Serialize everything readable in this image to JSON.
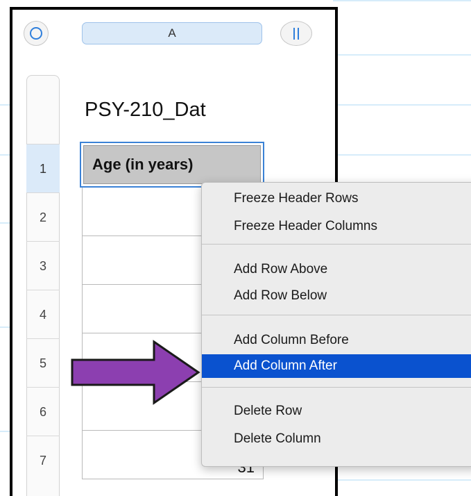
{
  "column_header": {
    "label": "A"
  },
  "table": {
    "title": "PSY-210_Dat",
    "header_cell": "Age (in years)",
    "rows": [
      "1",
      "2",
      "3",
      "4",
      "5",
      "6",
      "7"
    ],
    "partial_value_row7": "31"
  },
  "context_menu": {
    "groups": [
      [
        "Freeze Header Rows",
        "Freeze Header Columns"
      ],
      [
        "Add Row Above",
        "Add Row Below"
      ],
      [
        "Add Column Before",
        "Add Column After"
      ],
      [
        "Delete Row",
        "Delete Column"
      ]
    ],
    "highlighted_item": "Add Column After"
  },
  "icons": {
    "select_all": "circle-select-icon",
    "pause": "pause-icon",
    "pointer": "arrow-right-icon"
  },
  "colors": {
    "accent": "#2f7fdc",
    "highlight": "#0a52cf",
    "arrow_fill": "#8c3fb0",
    "header_cell_bg": "#c6c6c6"
  }
}
